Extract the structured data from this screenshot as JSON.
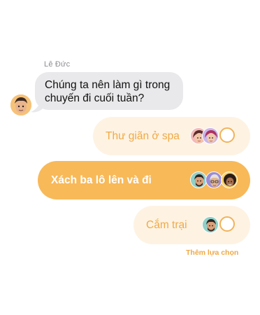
{
  "message": {
    "sender_name": "Lê Đức",
    "line1": "Chúng ta nên làm gì trong",
    "line2": "chuyến đi cuối tuần?"
  },
  "poll": {
    "options": [
      {
        "label": "Thư giãn ở spa",
        "voters": [
          "memoji-woman-pink",
          "memoji-woman-purple"
        ],
        "selected": false
      },
      {
        "label": "Xách ba lô lên và đi",
        "voters": [
          "memoji-man-beard",
          "memoji-man-glasses",
          "memoji-woman-curly"
        ],
        "selected": true
      },
      {
        "label": "Cắm trại",
        "voters": [
          "memoji-man-beard"
        ],
        "selected": false
      }
    ],
    "add_option_label": "Thêm lựa chọn"
  },
  "colors": {
    "accent": "#f8b959",
    "accent_text": "#f0a945",
    "option_bg": "#fef3e3",
    "bubble_bg": "#e9e9eb"
  }
}
